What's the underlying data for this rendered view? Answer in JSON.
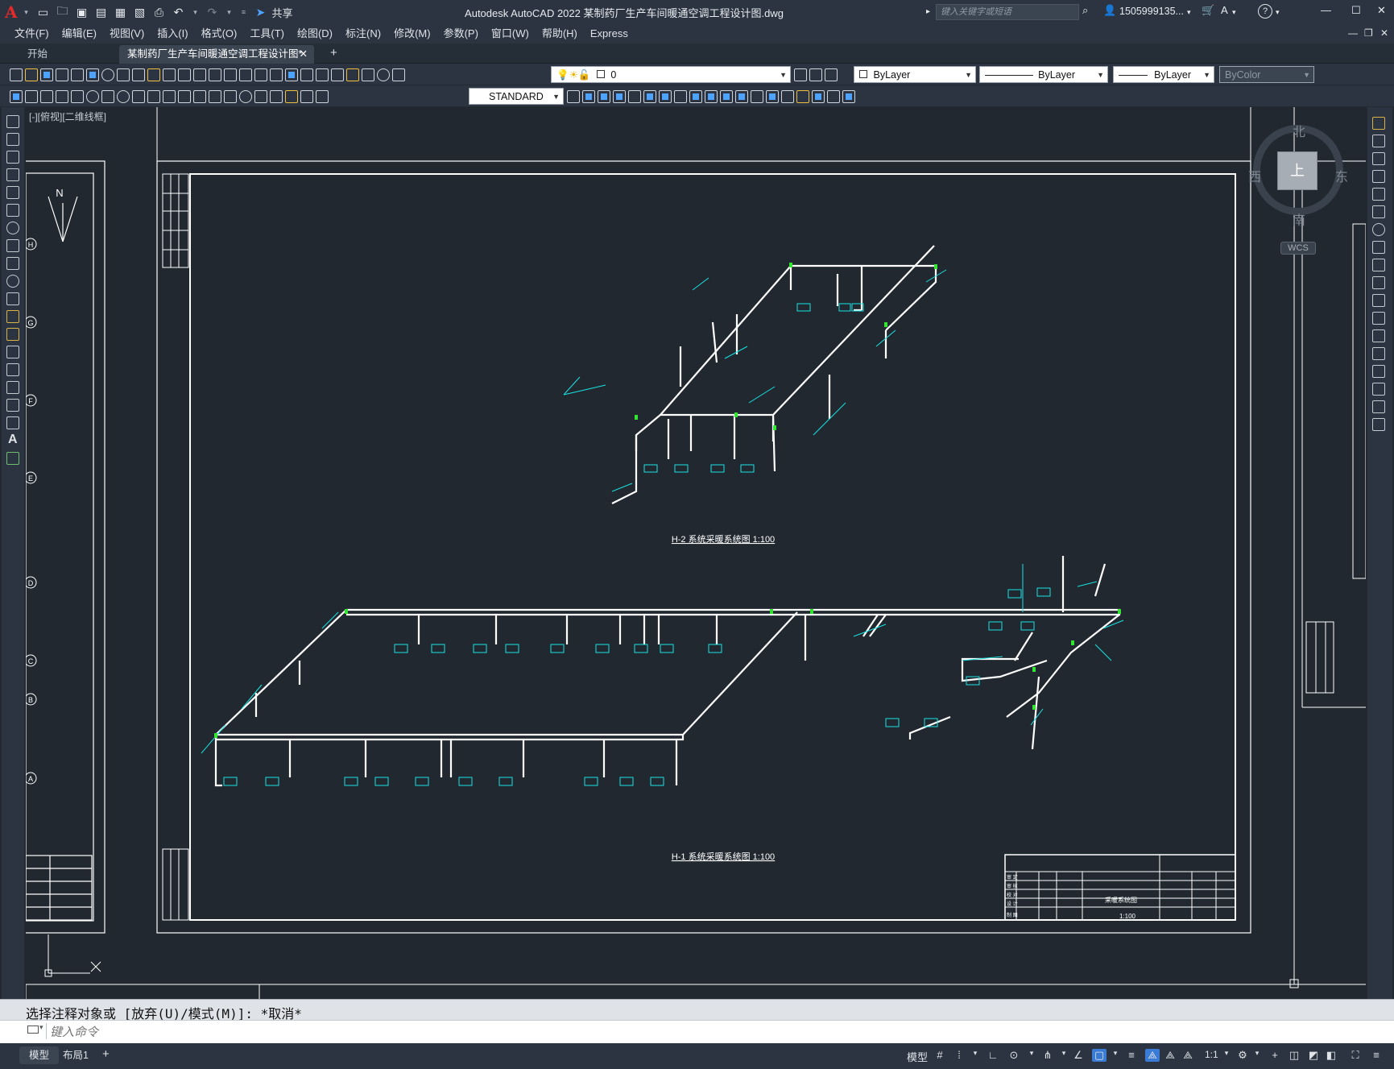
{
  "titlebar": {
    "share_label": "共享",
    "title": "Autodesk AutoCAD 2022    某制药厂生产车间暖通空调工程设计图.dwg",
    "search_placeholder": "键入关键字或短语",
    "user": "1505999135..."
  },
  "menu": [
    "文件(F)",
    "编辑(E)",
    "视图(V)",
    "插入(I)",
    "格式(O)",
    "工具(T)",
    "绘图(D)",
    "标注(N)",
    "修改(M)",
    "参数(P)",
    "窗口(W)",
    "帮助(H)",
    "Express"
  ],
  "tabs": {
    "start": "开始",
    "doc": "某制药厂生产车间暖通空调工程设计图*"
  },
  "toolbar": {
    "layer_value": "0",
    "color_value": "ByLayer",
    "linetype_value": "ByLayer",
    "lineweight_value": "ByLayer",
    "plotstyle_value": "ByColor",
    "textstyle_value": "STANDARD"
  },
  "viewport": {
    "label": "[-][俯视][二维线框]"
  },
  "viewcube": {
    "north": "北",
    "south": "南",
    "east": "东",
    "west": "西",
    "top": "上",
    "wcs": "WCS"
  },
  "drawing": {
    "caption_1": "H-1 系统采暖系统图 1:100",
    "caption_2": "H-2 系统采暖系统图 1:100",
    "north_label": "N",
    "left_grid_labels": [
      "H",
      "G",
      "F",
      "E",
      "D",
      "C",
      "B",
      "A"
    ],
    "tb_title": "采暖系统图",
    "tb_scale": "1:100",
    "tb_rows": [
      "审 定",
      "审 核",
      "校 对",
      "设 计",
      "制 图"
    ]
  },
  "command": {
    "history": "选择注释对象或 [放弃(U)/模式(M)]: *取消*",
    "placeholder": "键入命令"
  },
  "status": {
    "tab_model": "模型",
    "tab_layout": "布局1",
    "model_label": "模型",
    "scale": "1:1"
  }
}
